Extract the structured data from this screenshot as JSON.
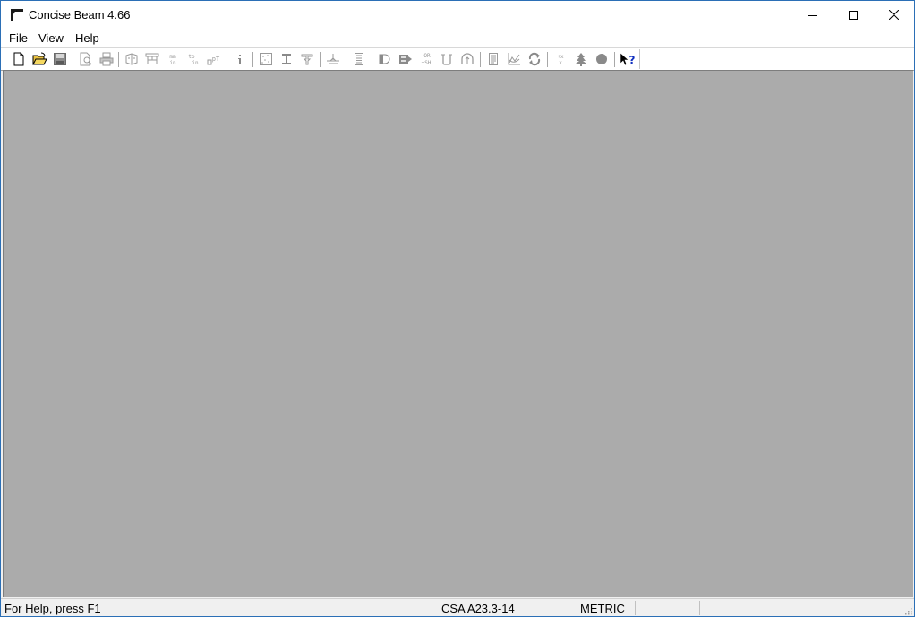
{
  "window": {
    "title": "Concise Beam 4.66",
    "controls": [
      "minimize-icon",
      "maximize-icon",
      "close-icon"
    ]
  },
  "menu": {
    "items": [
      {
        "label": "File"
      },
      {
        "label": "View"
      },
      {
        "label": "Help"
      }
    ]
  },
  "toolbar": {
    "groups": [
      [
        "new-document-icon",
        "open-folder-icon",
        "save-disk-icon"
      ],
      [
        "print-preview-icon",
        "print-icon"
      ],
      [
        "beam-geometry-icon",
        "span-table-icon",
        "mm-in-units-icon",
        "to-in-convert-icon",
        "text-size-icon"
      ],
      [
        "info-icon"
      ],
      [
        "section-icon",
        "i-beam-icon",
        "t-beam-icon"
      ],
      [
        "support-icon"
      ],
      [
        "calculator-icon"
      ],
      [
        "moment-icon",
        "shear-icon",
        "or-sh-icon",
        "stirrup-icon",
        "deflection-icon"
      ],
      [
        "report-icon",
        "graph-icon",
        "refresh-icon"
      ],
      [
        "cross-icon",
        "tree-icon",
        "circle-icon"
      ],
      [
        "context-help-icon"
      ]
    ],
    "context_help_glyph": "?"
  },
  "colors": {
    "client_background": "#ababab",
    "window_border": "#2b6fb6",
    "disabled_icon": "#9a9a9a"
  },
  "statusbar": {
    "help_text": "For Help, press F1",
    "code": "CSA A23.3-14",
    "units": "METRIC",
    "pane4": "",
    "pane5": ""
  }
}
